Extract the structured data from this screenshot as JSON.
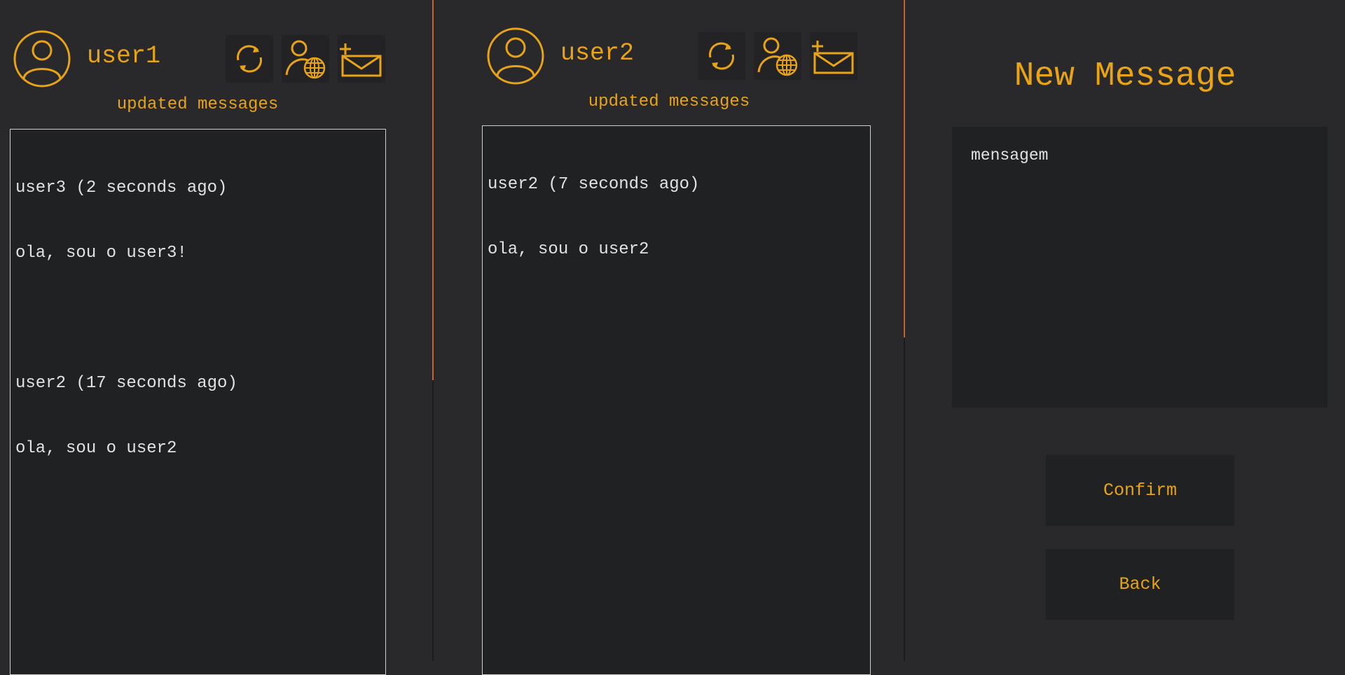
{
  "accent_color": "#e8a317",
  "panels": [
    {
      "username": "user1",
      "avatar_icon": "user-circle-icon",
      "toolbar": [
        {
          "icon": "refresh-icon"
        },
        {
          "icon": "user-globe-icon"
        },
        {
          "icon": "new-mail-icon"
        }
      ],
      "status": "updated messages",
      "messages": [
        {
          "header": "user3 (2 seconds ago)",
          "body": "ola, sou o user3!"
        },
        {
          "header": "user2 (17 seconds ago)",
          "body": "ola, sou o user2"
        }
      ]
    },
    {
      "username": "user2",
      "avatar_icon": "user-circle-icon",
      "toolbar": [
        {
          "icon": "refresh-icon"
        },
        {
          "icon": "user-globe-icon"
        },
        {
          "icon": "new-mail-icon"
        }
      ],
      "status": "updated messages",
      "messages": [
        {
          "header": "user2 (7 seconds ago)",
          "body": "ola, sou o user2"
        }
      ]
    }
  ],
  "new_message": {
    "title": "New Message",
    "input_placeholder": "mensagem",
    "confirm_label": "Confirm",
    "back_label": "Back"
  }
}
